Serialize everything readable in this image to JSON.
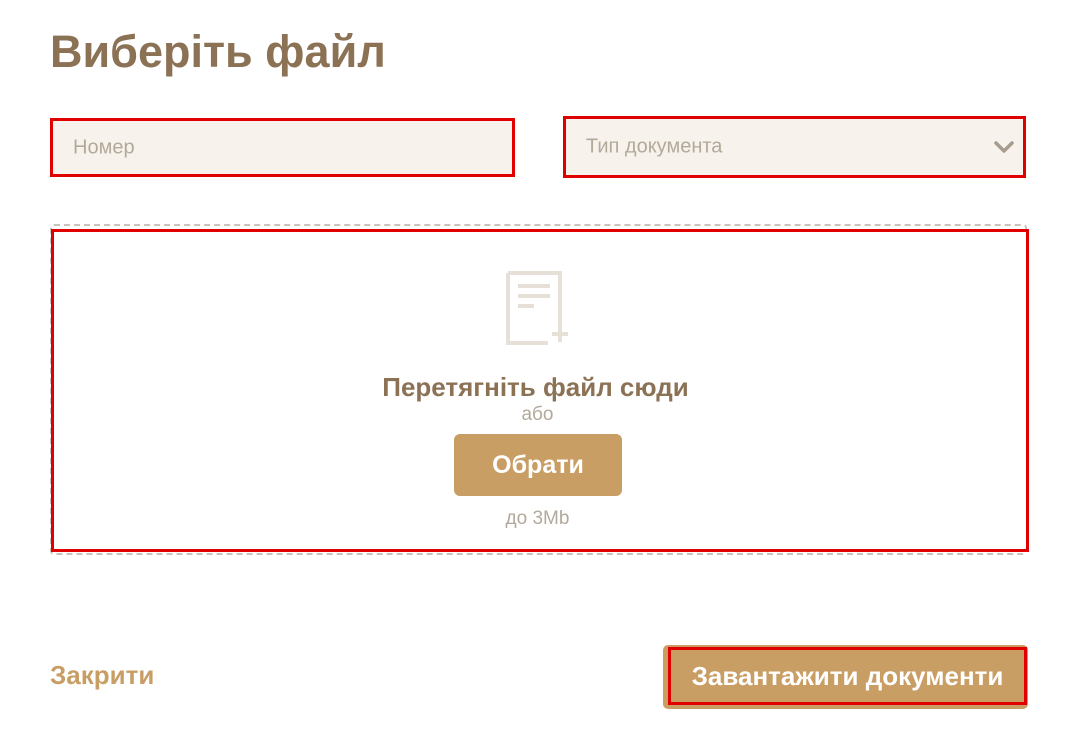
{
  "dialog": {
    "title": "Виберіть файл"
  },
  "form": {
    "number_placeholder": "Номер",
    "doc_type_placeholder": "Тип документа",
    "doc_type_icon": "chevron-down-icon"
  },
  "dropzone": {
    "icon": "document-add-icon",
    "drop_text": "Перетягніть файл сюди",
    "or_text": "або",
    "choose_label": "Обрати",
    "size_limit": "до 3Mb"
  },
  "footer": {
    "close_label": "Закрити",
    "upload_label": "Завантажити документи"
  },
  "colors": {
    "title": "#8c7255",
    "accent": "#c99e64",
    "field_bg": "#f7f3ec",
    "placeholder": "#b3a99b",
    "highlight_border": "#e00000"
  }
}
